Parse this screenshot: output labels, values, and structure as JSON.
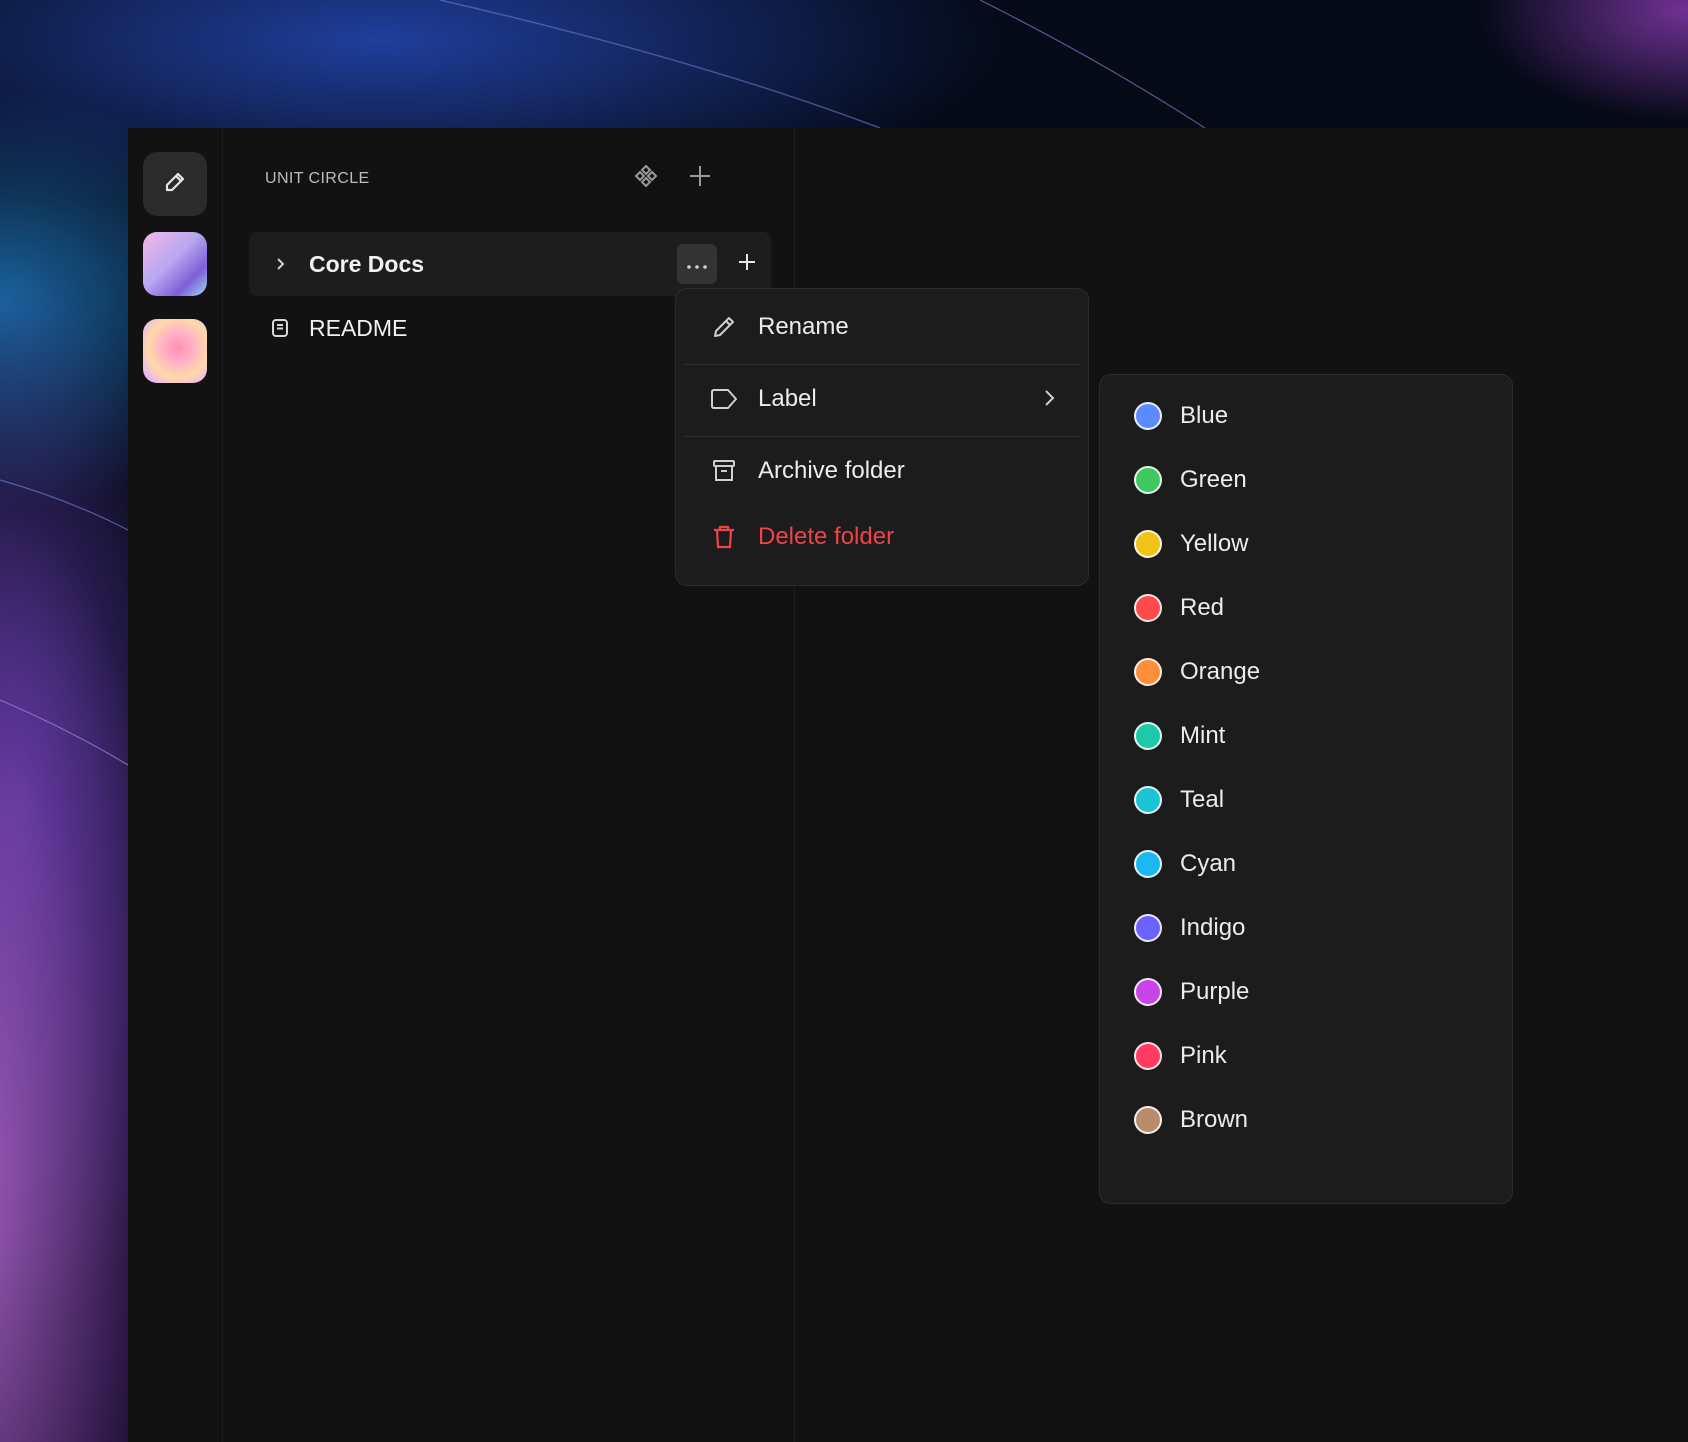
{
  "workspace": {
    "title": "UNIT CIRCLE"
  },
  "tree": {
    "items": [
      {
        "label": "Core Docs",
        "icon": "chevron-right-icon"
      },
      {
        "label": "README",
        "icon": "document-icon"
      }
    ]
  },
  "context_menu": {
    "items": [
      {
        "label": "Rename",
        "icon": "pencil-icon"
      },
      {
        "label": "Label",
        "icon": "tag-icon"
      },
      {
        "label": "Archive folder",
        "icon": "archive-icon"
      },
      {
        "label": "Delete folder",
        "icon": "trash-icon"
      }
    ],
    "danger_color": "#f0424a"
  },
  "label_menu": {
    "colors": [
      {
        "label": "Blue",
        "hex": "#5b8cff"
      },
      {
        "label": "Green",
        "hex": "#3fc85f"
      },
      {
        "label": "Yellow",
        "hex": "#f0c419"
      },
      {
        "label": "Red",
        "hex": "#ff4a4a"
      },
      {
        "label": "Orange",
        "hex": "#ff8f3a"
      },
      {
        "label": "Mint",
        "hex": "#1ec8a8"
      },
      {
        "label": "Teal",
        "hex": "#1bc3d6"
      },
      {
        "label": "Cyan",
        "hex": "#1eb8f0"
      },
      {
        "label": "Indigo",
        "hex": "#6c63ff"
      },
      {
        "label": "Purple",
        "hex": "#c845e8"
      },
      {
        "label": "Pink",
        "hex": "#ff3b62"
      },
      {
        "label": "Brown",
        "hex": "#b88c6a"
      }
    ]
  }
}
